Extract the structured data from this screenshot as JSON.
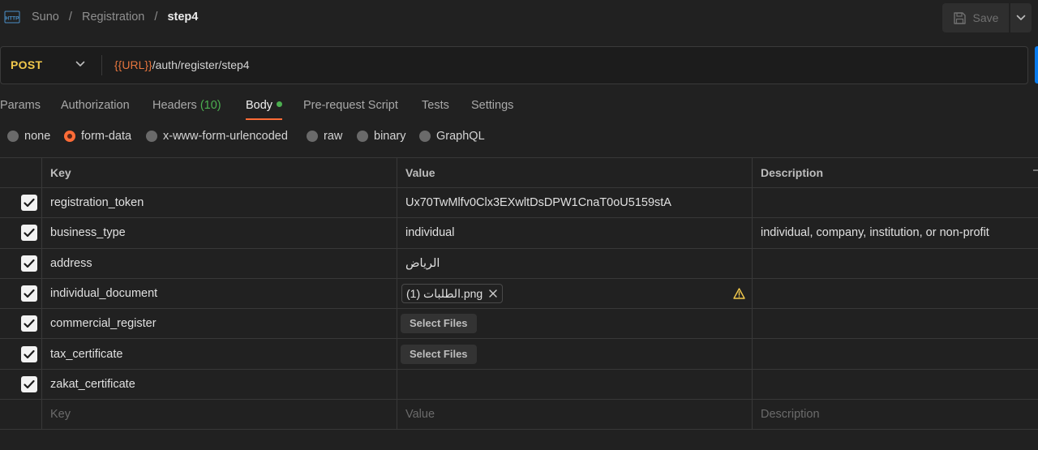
{
  "breadcrumb": {
    "items": [
      "Suno",
      "Registration"
    ],
    "separator": "/",
    "current": "step4"
  },
  "toolbar": {
    "save_label": "Save"
  },
  "request": {
    "method": "POST",
    "url_variable": "{{URL}}",
    "url_path": "/auth/register/step4"
  },
  "tabs": {
    "params": "Params",
    "authorization": "Authorization",
    "headers": "Headers",
    "headers_count": "(10)",
    "body": "Body",
    "prerequest": "Pre-request Script",
    "tests": "Tests",
    "settings": "Settings",
    "active": "Body"
  },
  "body_types": {
    "options": [
      "none",
      "form-data",
      "x-www-form-urlencoded",
      "raw",
      "binary",
      "GraphQL"
    ],
    "selected": "form-data"
  },
  "table": {
    "headers": {
      "key": "Key",
      "value": "Value",
      "description": "Description"
    },
    "rows": [
      {
        "checked": true,
        "key": "registration_token",
        "value": "Ux70TwMlfv0Clx3EXwltDsDPW1CnaT0oU5159stA",
        "description": ""
      },
      {
        "checked": true,
        "key": "business_type",
        "value": "individual",
        "description": "individual, company, institution, or non-profit"
      },
      {
        "checked": true,
        "key": "address",
        "value": "الرياض",
        "description": ""
      },
      {
        "checked": true,
        "key": "individual_document",
        "file": "الطلبات (1).png",
        "warning": true,
        "description": ""
      },
      {
        "checked": true,
        "key": "commercial_register",
        "button": "Select Files",
        "description": ""
      },
      {
        "checked": true,
        "key": "tax_certificate",
        "button": "Select Files",
        "description": ""
      },
      {
        "checked": true,
        "key": "zakat_certificate",
        "value": "",
        "description": ""
      }
    ],
    "placeholders": {
      "key": "Key",
      "value": "Value",
      "description": "Description"
    }
  },
  "colors": {
    "background": "#212121",
    "method_post": "#f2c94c",
    "url_variable": "#e8763e",
    "accent": "#ff6c37",
    "status_green": "#4caf50",
    "send_blue": "#097bed"
  }
}
